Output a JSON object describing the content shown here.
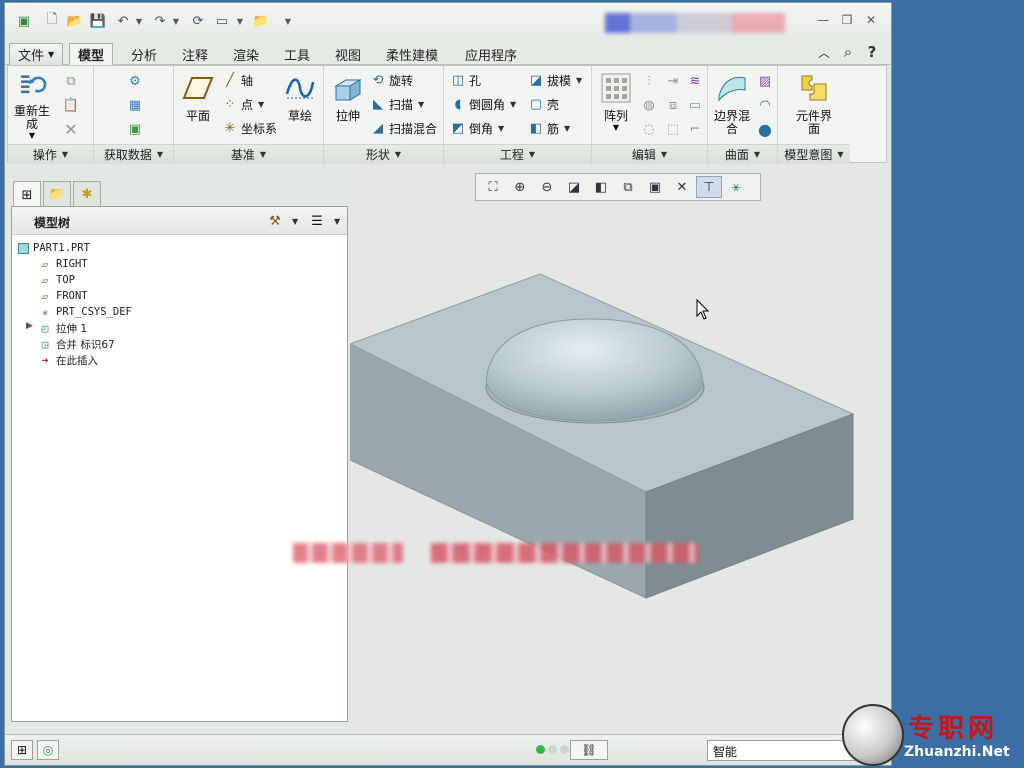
{
  "ribbon_tabs": [
    "文件",
    "模型",
    "分析",
    "注释",
    "渲染",
    "工具",
    "视图",
    "柔性建模",
    "应用程序"
  ],
  "active_tab": "模型",
  "groups": {
    "operations": {
      "label": "操作",
      "regen": "重新生成"
    },
    "get_data": {
      "label": "获取数据"
    },
    "datum": {
      "label": "基准",
      "plane": "平面",
      "axis": "轴",
      "point": "点",
      "csys": "坐标系",
      "sketch": "草绘"
    },
    "shapes": {
      "label": "形状",
      "extrude": "拉伸",
      "revolve": "旋转",
      "sweep": "扫描",
      "swept_blend": "扫描混合"
    },
    "engineering": {
      "label": "工程",
      "hole": "孔",
      "round": "倒圆角",
      "chamfer": "倒角",
      "draft": "拔模",
      "shell": "壳",
      "rib": "筋"
    },
    "editing": {
      "label": "编辑",
      "pattern": "阵列"
    },
    "surfaces": {
      "label": "曲面",
      "boundary_blend": "边界混合"
    },
    "model_intent": {
      "label": "模型意图",
      "component_interface": "元件界面"
    }
  },
  "model_tree": {
    "title": "模型树",
    "items": [
      {
        "text": "PART1.PRT",
        "icon": "part-icon"
      },
      {
        "text": "RIGHT",
        "icon": "datum-plane-icon"
      },
      {
        "text": "TOP",
        "icon": "datum-plane-icon"
      },
      {
        "text": "FRONT",
        "icon": "datum-plane-icon"
      },
      {
        "text": "PRT_CSYS_DEF",
        "icon": "csys-icon"
      },
      {
        "text": "拉伸 1",
        "icon": "extrude-feature-icon"
      },
      {
        "text": "合并 标识67",
        "icon": "merge-feature-icon"
      },
      {
        "text": "在此插入",
        "icon": "insert-here-arrow-icon"
      }
    ]
  },
  "status": {
    "filter": "智能"
  },
  "watermark": {
    "cn": "专职网",
    "en": "Zhuanzhi.Net"
  },
  "colors": {
    "desktop": "#3a6ea5",
    "model_face_top": "#b7c6cb",
    "model_face_front": "#9aa8ad",
    "model_face_side": "#7f8d92",
    "insert_arrow": "#c0161b",
    "watermark_red": "#c21818"
  }
}
